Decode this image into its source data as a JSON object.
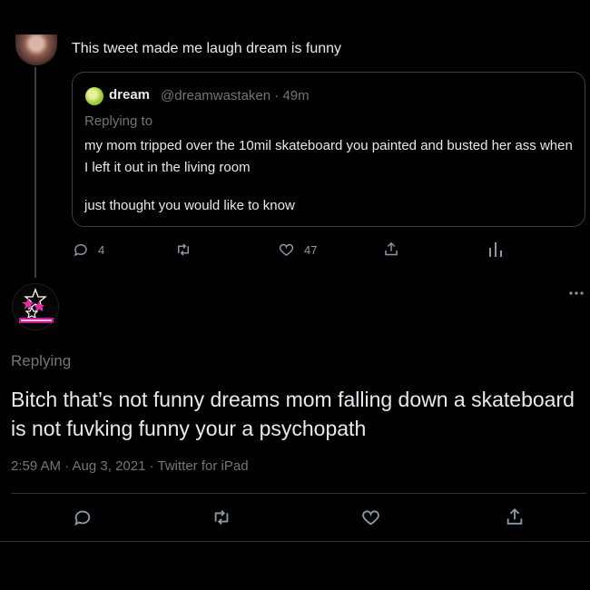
{
  "parent_tweet": {
    "text": "This tweet made me laugh dream is funny",
    "quote": {
      "name": "dream",
      "handle_time": "@dreamwastaken · 49m",
      "replying": "Replying to",
      "body_1": "my mom tripped over the 10mil skateboard you painted and busted her ass when I left it out in the living room",
      "body_2": "just thought you would like to know"
    },
    "actions": {
      "replies": "4",
      "likes": "47"
    }
  },
  "main_tweet": {
    "replying": "Replying",
    "text": "Bitch that’s not funny dreams mom falling down a skateboard is not fuvking funny your a psychopath",
    "meta": "2:59 AM · Aug 3, 2021 · Twitter for iPad"
  },
  "colors": {
    "background": "#000000",
    "text": "#e7e9ea",
    "muted": "#71767b",
    "border": "#2f3336"
  },
  "icons": [
    "reply-icon",
    "retweet-icon",
    "like-icon",
    "share-icon",
    "analytics-icon",
    "more-icon"
  ]
}
